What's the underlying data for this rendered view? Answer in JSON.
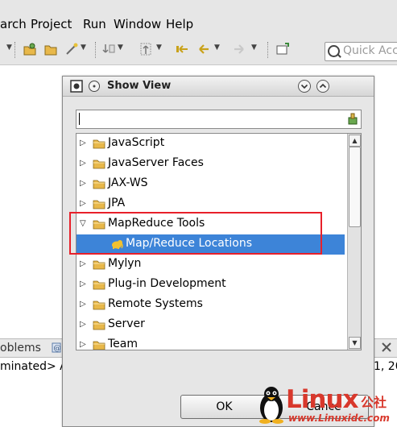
{
  "menubar": {
    "items": [
      "arch",
      "Project",
      "Run",
      "Window",
      "Help"
    ],
    "mnemonics": [
      "",
      "P",
      "R",
      "W",
      "H"
    ]
  },
  "toolbar": {
    "quick_access_placeholder": "Quick Acc"
  },
  "dialog": {
    "title": "Show View",
    "filter_value": "",
    "tree": [
      {
        "label": "JavaScript",
        "expanded": false,
        "icon": "folder-icon"
      },
      {
        "label": "JavaServer Faces",
        "expanded": false,
        "icon": "folder-icon"
      },
      {
        "label": "JAX-WS",
        "expanded": false,
        "icon": "folder-icon"
      },
      {
        "label": "JPA",
        "expanded": false,
        "icon": "folder-icon"
      },
      {
        "label": "MapReduce Tools",
        "expanded": true,
        "icon": "folder-icon"
      },
      {
        "label": "Map/Reduce Locations",
        "child": true,
        "selected": true,
        "icon": "elephant-icon"
      },
      {
        "label": "Mylyn",
        "expanded": false,
        "icon": "folder-icon"
      },
      {
        "label": "Plug-in Development",
        "expanded": false,
        "icon": "folder-icon"
      },
      {
        "label": "Remote Systems",
        "expanded": false,
        "icon": "folder-icon"
      },
      {
        "label": "Server",
        "expanded": false,
        "icon": "folder-icon"
      },
      {
        "label": "Team",
        "expanded": false,
        "icon": "folder-icon"
      }
    ],
    "ok_label": "OK",
    "cancel_label": "Cance"
  },
  "workbench": {
    "bottom_tab_label": "oblems",
    "console_left": "minated> A",
    "console_right": "1, 20"
  },
  "watermark": {
    "brand": "Linux",
    "chinese": "公社",
    "url": "www.Linuxidc.com"
  },
  "colors": {
    "selection": "#3d84d8",
    "highlight_box": "#e8202a",
    "folder": "#e8b84a"
  }
}
